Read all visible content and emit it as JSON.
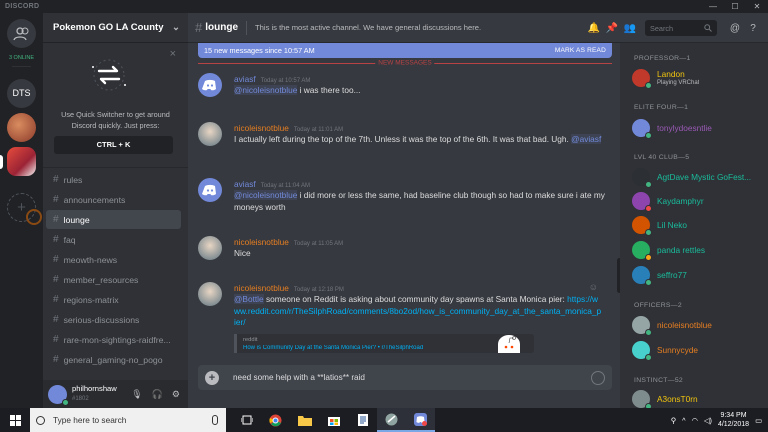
{
  "titlebar": {
    "app_name": "DISCORD",
    "minimize": "—",
    "maximize": "☐",
    "close": "✕"
  },
  "guilds": {
    "online_label": "3 ONLINE",
    "dts_label": "DTS",
    "add_label": "+"
  },
  "server": {
    "name": "Pokemon GO LA County",
    "chevron": "⌄"
  },
  "quick_switcher": {
    "close": "×",
    "text": "Use Quick Switcher to get around Discord quickly. Just press:",
    "shortcut": "CTRL + K"
  },
  "channels": [
    {
      "hash": "#",
      "name": "rules"
    },
    {
      "hash": "#",
      "name": "announcements"
    },
    {
      "hash": "#",
      "name": "lounge",
      "selected": true
    },
    {
      "hash": "#",
      "name": "faq"
    },
    {
      "hash": "#",
      "name": "meowth-news"
    },
    {
      "hash": "#",
      "name": "member_resources"
    },
    {
      "hash": "#",
      "name": "regions-matrix"
    },
    {
      "hash": "#",
      "name": "serious-discussions"
    },
    {
      "hash": "#",
      "name": "rare-mon-sightings-raidfre..."
    },
    {
      "hash": "#",
      "name": "general_gaming-no_pogo"
    }
  ],
  "user": {
    "name": "philhornshaw",
    "tag": "#1802",
    "mic": "🎙",
    "headset": "🎧",
    "settings": "⚙"
  },
  "topbar": {
    "hash": "#",
    "channel": "lounge",
    "topic": "This is the most active channel. We have general discussions here.",
    "search_placeholder": "Search",
    "bell": "🔔",
    "pin": "📌",
    "members": "👥",
    "at": "@",
    "help": "?"
  },
  "new_messages": {
    "text": "15 new messages since 10:57 AM",
    "action": "MARK AS READ",
    "divider": "NEW MESSAGES"
  },
  "messages": [
    {
      "user": "aviasf",
      "time": "Today at 10:57 AM",
      "mention": "@nicoleisnotblue",
      "text": " i was there too..."
    },
    {
      "user": "nicoleisnotblue",
      "time": "Today at 11:01 AM",
      "text": "I actually left during the top of the 7th. Unless it was the top of the 6th. It was that bad. Ugh. ",
      "mention": "@aviasf"
    },
    {
      "user": "aviasf",
      "time": "Today at 11:04 AM",
      "mention": "@nicoleisnotblue",
      "text": " i did more or less the same, had baseline club though so had to make sure i ate my moneys worth"
    },
    {
      "user": "nicoleisnotblue",
      "time": "Today at 11:05 AM",
      "text": "Nice"
    },
    {
      "user": "nicoleisnotblue",
      "time": "Today at 12:18 PM",
      "mention": "@Bottle",
      "text": " someone on Reddit is asking about community day spawns at Santa Monica pier: ",
      "link": "https://www.reddit.com/r/TheSilphRoad/comments/8bo2od/how_is_community_day_at_the_santa_monica_pier/",
      "embed_provider": "reddit",
      "embed_title": "How is Community Day at the Santa Monica Pier? • r/TheSilphRoad"
    }
  ],
  "composer": {
    "plus": "+",
    "text": "need some help with a **latios** raid"
  },
  "members": {
    "sections": [
      {
        "title": "PROFESSOR—1"
      },
      {
        "title": "ELITE FOUR—1"
      },
      {
        "title": "LVL 40 CLUB—5"
      },
      {
        "title": "OFFICERS—2"
      },
      {
        "title": "INSTINCT—52"
      }
    ],
    "list": [
      {
        "name": "Landon",
        "sub": "Playing VRChat",
        "color": "#f1c40f",
        "status": "#43b581",
        "avatar": "#c0392b"
      },
      {
        "name": "tonylydoesntlie",
        "color": "#9b59b6",
        "status": "#43b581",
        "avatar": "#7289da"
      },
      {
        "name": "AgtDave Mystic GoFest...",
        "color": "#1abc9c",
        "status": "#43b581",
        "avatar": "#2c2f33"
      },
      {
        "name": "Kaydamphyr",
        "color": "#1abc9c",
        "status": "#f04747",
        "avatar": "#8e44ad"
      },
      {
        "name": "Lil Neko",
        "color": "#1abc9c",
        "status": "#43b581",
        "avatar": "#d35400"
      },
      {
        "name": "panda rettles",
        "color": "#1abc9c",
        "status": "#faa61a",
        "avatar": "#27ae60"
      },
      {
        "name": "seffro77",
        "color": "#1abc9c",
        "status": "#43b581",
        "avatar": "#2980b9"
      },
      {
        "name": "nicoleisnotblue",
        "color": "#e67e22",
        "status": "#43b581",
        "avatar": "#95a5a6"
      },
      {
        "name": "Sunnycyde",
        "color": "#e67e22",
        "status": "#43b581",
        "avatar": "#48d1cc"
      },
      {
        "name": "A3onsT0rn",
        "color": "#f1c40f",
        "status": "#43b581",
        "avatar": "#7f8c8d"
      }
    ]
  },
  "taskbar": {
    "search_placeholder": "Type here to search",
    "time": "9:34 PM",
    "date": "4/12/2018"
  },
  "colors": {
    "blurple": "#7289da",
    "red": "#f04747",
    "green": "#43b581"
  }
}
